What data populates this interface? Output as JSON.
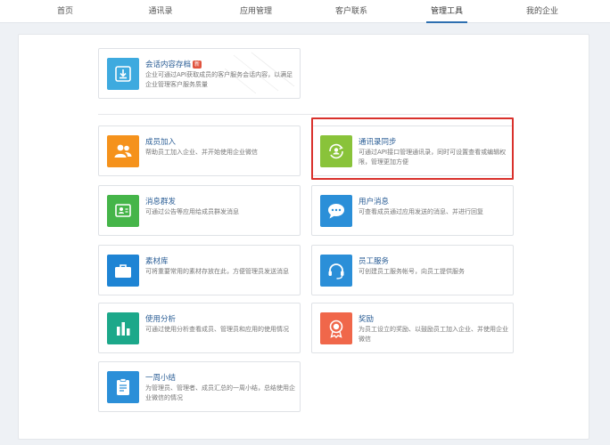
{
  "nav": {
    "items": [
      {
        "label": "首页"
      },
      {
        "label": "通讯录"
      },
      {
        "label": "应用管理"
      },
      {
        "label": "客户联系"
      },
      {
        "label": "管理工具"
      },
      {
        "label": "我的企业"
      }
    ],
    "active_index": 4
  },
  "archive": {
    "title": "会话内容存档",
    "badge": "新",
    "desc": "企业可通过API获取成员的客户服务会话内容，以满足企业管理客户服务质量"
  },
  "cards": [
    {
      "title": "成员加入",
      "desc": "帮助员工加入企业、并开始使用企业微信",
      "icon": "people-icon",
      "color": "#f5921c"
    },
    {
      "title": "通讯录同步",
      "desc": "可通过API接口管理通讯录，同时可设置查看或编辑权限，管理更加方便",
      "icon": "sync-contacts-icon",
      "color": "#89c33a"
    },
    {
      "title": "消息群发",
      "desc": "可通过公告等应用给成员群发消息",
      "icon": "broadcast-icon",
      "color": "#45b549"
    },
    {
      "title": "用户消息",
      "desc": "可查看成员通过应用发送的消息、并进行回复",
      "icon": "chat-bubble-icon",
      "color": "#2b8fd8"
    },
    {
      "title": "素材库",
      "desc": "可将重要常用的素材存放在此，方便管理员发送消息",
      "icon": "briefcase-icon",
      "color": "#1e84d4"
    },
    {
      "title": "员工服务",
      "desc": "可创建员工服务帐号，向员工提供服务",
      "icon": "headset-icon",
      "color": "#2b8fd8"
    },
    {
      "title": "使用分析",
      "desc": "可通过使用分析查看成员、管理员和应用的使用情况",
      "icon": "bar-chart-icon",
      "color": "#1ca88a"
    },
    {
      "title": "奖励",
      "desc": "为员工设立的奖励、以鼓励员工加入企业、并使用企业微信",
      "icon": "award-icon",
      "color": "#f0674a"
    },
    {
      "title": "一周小结",
      "desc": "为管理员、管理者、成员汇总的一周小结，总结使用企业微信的情况",
      "icon": "clipboard-icon",
      "color": "#2b8fd8"
    }
  ]
}
